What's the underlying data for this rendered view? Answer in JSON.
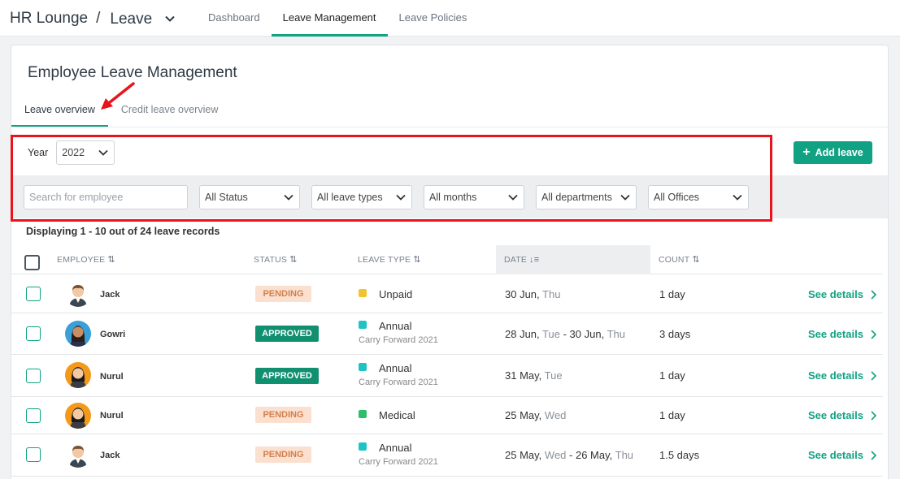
{
  "header": {
    "app_name": "HR Lounge",
    "separator": "/",
    "module": "Leave",
    "tabs": [
      {
        "label": "Dashboard"
      },
      {
        "label": "Leave Management"
      },
      {
        "label": "Leave Policies"
      }
    ],
    "active_tab": "Leave Management"
  },
  "page": {
    "title": "Employee Leave Management",
    "subtabs": [
      {
        "label": "Leave overview"
      },
      {
        "label": "Credit leave overview"
      }
    ]
  },
  "filters": {
    "year_label": "Year",
    "year_value": "2022",
    "add_button": "Add leave",
    "search_placeholder": "Search for employee",
    "status": "All Status",
    "leave_types": "All leave types",
    "months": "All months",
    "departments": "All departments",
    "offices": "All Offices"
  },
  "records_info": "Displaying 1 - 10 out of 24 leave records",
  "table": {
    "headers": {
      "employee": "EMPLOYEE",
      "status": "STATUS",
      "leave_type": "LEAVE TYPE",
      "date": "DATE",
      "count": "COUNT"
    },
    "details_label": "See details",
    "rows": [
      {
        "name": "Jack",
        "status": "PENDING",
        "type": "Unpaid",
        "sub": "",
        "date1": "30 Jun,",
        "wd1": "Thu",
        "date2": "",
        "wd2": "",
        "count": "1 day"
      },
      {
        "name": "Gowri",
        "status": "APPROVED",
        "type": "Annual",
        "sub": "Carry Forward 2021",
        "date1": "28 Jun,",
        "wd1": "Tue",
        "date2": "- 30 Jun,",
        "wd2": "Thu",
        "count": "3 days"
      },
      {
        "name": "Nurul",
        "status": "APPROVED",
        "type": "Annual",
        "sub": "Carry Forward 2021",
        "date1": "31 May,",
        "wd1": "Tue",
        "date2": "",
        "wd2": "",
        "count": "1 day"
      },
      {
        "name": "Nurul",
        "status": "PENDING",
        "type": "Medical",
        "sub": "",
        "date1": "25 May,",
        "wd1": "Wed",
        "date2": "",
        "wd2": "",
        "count": "1 day"
      },
      {
        "name": "Jack",
        "status": "PENDING",
        "type": "Annual",
        "sub": "Carry Forward 2021",
        "date1": "25 May,",
        "wd1": "Wed",
        "date2": "- 26 May,",
        "wd2": "Thu",
        "count": "1.5 days"
      }
    ]
  },
  "colors": {
    "accent": "#11a283",
    "highlight": "#e8141b",
    "unpaid": "#f2c42b",
    "annual": "#1fc3c3",
    "medical": "#2ebd6b"
  }
}
